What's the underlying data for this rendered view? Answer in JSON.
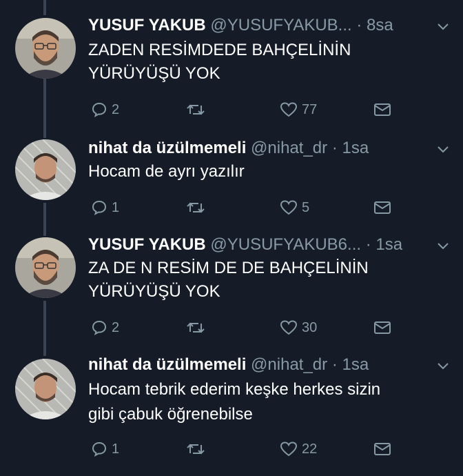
{
  "tweets": [
    {
      "name": "YUSUF YAKUB",
      "handle": "@YUSUFYAKUB...",
      "dot": "·",
      "time": "8sa",
      "lines": [
        "ZADEN RESİMDEDE BAHÇELİNİN",
        "YÜRÜYÜŞÜ YOK"
      ],
      "reply_count": "2",
      "retweet_count": "",
      "like_count": "77",
      "avatar": "bearded-man-glasses"
    },
    {
      "name": "nihat da üzülmemeli",
      "handle": "@nihat_dr",
      "dot": "·",
      "time": "1sa",
      "lines": [
        "Hocam de ayrı yazılır"
      ],
      "reply_count": "1",
      "retweet_count": "",
      "like_count": "5",
      "avatar": "young-man"
    },
    {
      "name": "YUSUF YAKUB",
      "handle": "@YUSUFYAKUB6...",
      "dot": "·",
      "time": "1sa",
      "lines": [
        "ZA DE N RESİM DE DE BAHÇELİNİN",
        "YÜRÜYÜŞÜ YOK"
      ],
      "reply_count": "2",
      "retweet_count": "",
      "like_count": "30",
      "avatar": "bearded-man-glasses"
    },
    {
      "name": "nihat da üzülmemeli",
      "handle": "@nihat_dr",
      "dot": "·",
      "time": "1sa",
      "lines": [
        "Hocam tebrik ederim keşke herkes sizin",
        "gibi çabuk öğrenebilse"
      ],
      "reply_count": "1",
      "retweet_count": "",
      "like_count": "22",
      "avatar": "young-man"
    }
  ],
  "icons": {
    "reply": "reply-icon",
    "retweet": "retweet-icon",
    "like": "heart-icon",
    "dm": "envelope-icon",
    "menu": "chevron-down-icon"
  },
  "colors": {
    "background": "#151c28",
    "muted": "#8899a6",
    "text": "#ffffff",
    "thread_line": "#3a4452"
  }
}
